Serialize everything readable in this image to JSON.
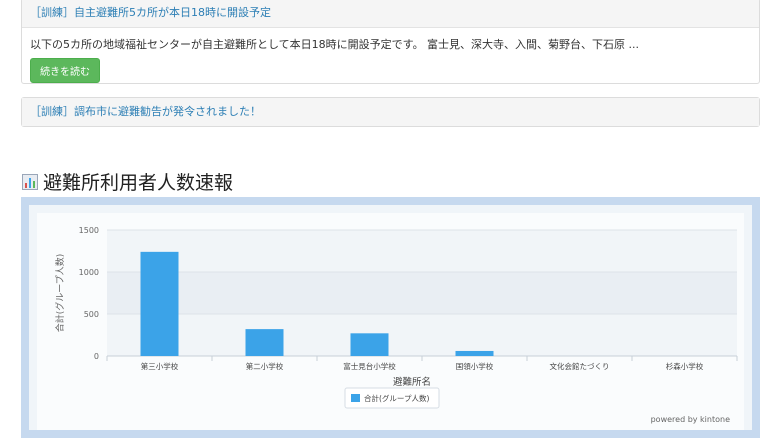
{
  "notices": [
    {
      "title": "［訓練］自主避難所5カ所が本日18時に開設予定",
      "body": "以下の5カ所の地域福祉センターが自主避難所として本日18時に開設予定です。 富士見、深大寺、入間、菊野台、下石原 ...",
      "button": "続きを読む"
    },
    {
      "title": "［訓練］調布市に避難勧告が発令されました！"
    }
  ],
  "section": {
    "title": "避難所利用者人数速報",
    "icon": "bar-chart-icon"
  },
  "colors": {
    "accent": "#2d7fb5",
    "bar": "#3ba3e8",
    "button": "#5cb85c",
    "frame": "#c6d9ef"
  },
  "chart_data": {
    "type": "bar",
    "categories": [
      "第三小学校",
      "第二小学校",
      "富士見台小学校",
      "国領小学校",
      "文化会館たづくり",
      "杉森小学校"
    ],
    "series": [
      {
        "name": "合計(グループ人数)",
        "values": [
          1240,
          320,
          270,
          60,
          0,
          0
        ]
      }
    ],
    "xlabel": "避難所名",
    "ylabel": "合計(グループ人数)",
    "ylim": [
      0,
      1500
    ],
    "yticks": [
      0,
      500,
      1000,
      1500
    ],
    "legend": "bottom-center",
    "grid": true,
    "footer": "powered by kintone"
  }
}
